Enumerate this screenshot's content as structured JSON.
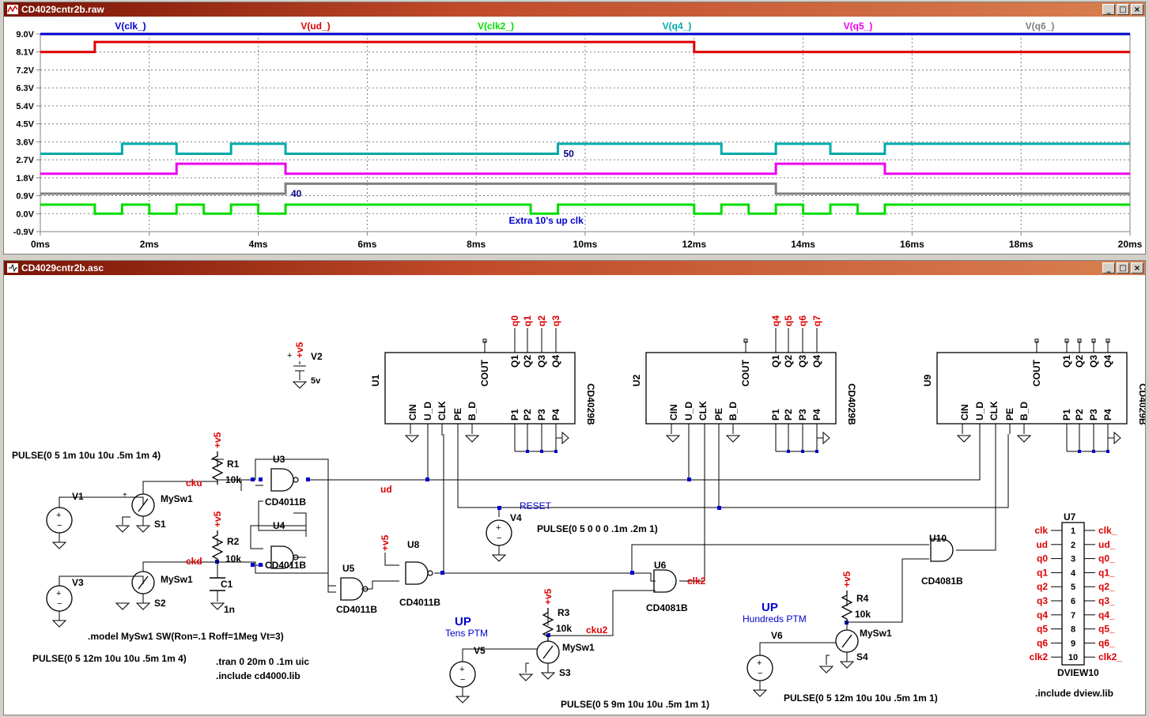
{
  "waveform_window": {
    "title": "CD4029cntr2b.raw",
    "buttons": [
      "_",
      "□",
      "×"
    ]
  },
  "schematic_window": {
    "title": "CD4029cntr2b.asc",
    "buttons": [
      "_",
      "□",
      "×"
    ]
  },
  "chart_data": {
    "type": "line",
    "x_unit": "ms",
    "xlim": [
      0,
      20
    ],
    "ylim": [
      -0.9,
      9.0
    ],
    "y_ticks": [
      "9.0V",
      "8.1V",
      "7.2V",
      "6.3V",
      "5.4V",
      "4.5V",
      "3.6V",
      "2.7V",
      "1.8V",
      "0.9V",
      "0.0V",
      "-0.9V"
    ],
    "x_ticks": [
      "0ms",
      "2ms",
      "4ms",
      "6ms",
      "8ms",
      "10ms",
      "12ms",
      "14ms",
      "16ms",
      "18ms",
      "20ms"
    ],
    "grid": true,
    "series": [
      {
        "name": "V(clk_)",
        "color": "#0000cc",
        "x": [
          0,
          20
        ],
        "y": [
          9.0,
          9.0
        ]
      },
      {
        "name": "V(ud_)",
        "color": "#dd0000",
        "x": [
          0,
          1,
          1,
          12,
          12,
          20
        ],
        "y": [
          8.1,
          8.1,
          8.6,
          8.6,
          8.1,
          8.1
        ]
      },
      {
        "name": "V(clk2_)",
        "color": "#00dd00",
        "x": [
          0,
          1,
          1,
          1.5,
          1.5,
          2,
          2,
          2.5,
          2.5,
          3,
          3,
          3.5,
          3.5,
          4,
          4,
          4.5,
          4.5,
          9,
          9,
          9.5,
          9.5,
          12,
          12,
          12.5,
          12.5,
          13,
          13,
          13.5,
          13.5,
          14,
          14,
          14.5,
          14.5,
          15,
          15,
          15.5,
          15.5,
          20
        ],
        "y": [
          0.45,
          0.45,
          0,
          0,
          0.45,
          0.45,
          0,
          0,
          0.45,
          0.45,
          0,
          0,
          0.45,
          0.45,
          0,
          0,
          0.45,
          0.45,
          0,
          0,
          0.45,
          0.45,
          0,
          0,
          0.45,
          0.45,
          0,
          0,
          0.45,
          0.45,
          0,
          0,
          0.45,
          0.45,
          0,
          0,
          0.45,
          0.45
        ]
      },
      {
        "name": "V(q4_)",
        "color": "#00aaaa",
        "x": [
          0,
          1.5,
          1.5,
          2.5,
          2.5,
          3.5,
          3.5,
          4.5,
          4.5,
          9.5,
          9.5,
          12.5,
          12.5,
          13.5,
          13.5,
          14.5,
          14.5,
          15.5,
          15.5,
          20
        ],
        "y": [
          3.0,
          3.0,
          3.5,
          3.5,
          3.0,
          3.0,
          3.5,
          3.5,
          3.0,
          3.0,
          3.5,
          3.5,
          3.0,
          3.0,
          3.5,
          3.5,
          3.0,
          3.0,
          3.5,
          3.5
        ]
      },
      {
        "name": "V(q5_)",
        "color": "#ee00ee",
        "x": [
          0,
          2.5,
          2.5,
          4.5,
          4.5,
          13.5,
          13.5,
          15.5,
          15.5,
          20
        ],
        "y": [
          2.0,
          2.0,
          2.5,
          2.5,
          2.0,
          2.0,
          2.5,
          2.5,
          2.0,
          2.0
        ]
      },
      {
        "name": "V(q6_)",
        "color": "#808080",
        "x": [
          0,
          4.5,
          4.5,
          13.5,
          13.5,
          20
        ],
        "y": [
          1.0,
          1.0,
          1.5,
          1.5,
          1.0,
          1.0
        ]
      }
    ],
    "annotations": [
      {
        "text": "50",
        "x": 9.6,
        "y": 2.85,
        "color": "#000080"
      },
      {
        "text": "40",
        "x": 4.6,
        "y": 0.85,
        "color": "#000080"
      },
      {
        "text": "Extra 10's up clk",
        "x": 8.6,
        "y": -0.5,
        "color": "#0000cc"
      }
    ]
  },
  "schematic": {
    "directives": {
      "pulse1": "PULSE(0 5 1m 10u 10u .5m 1m 4)",
      "pulse2": "PULSE(0 5 12m 10u 10u .5m 1m 4)",
      "pulse_reset": "PULSE(0 5 0 0 0 .1m .2m 1)",
      "pulse3": "PULSE(0 5 9m 10u 10u .5m 1m 1)",
      "pulse4": "PULSE(0 5 12m 10u 10u .5m 1m 1)",
      "model": ".model MySw1  SW(Ron=.1 Roff=1Meg Vt=3)",
      "tran": ".tran 0 20m 0 .1m uic",
      "include1": ".include cd4000.lib",
      "include2": ".include dview.lib"
    },
    "labels": {
      "up1": "UP",
      "tens": "Tens PTM",
      "up2": "UP",
      "hundreds": "Hundreds PTM",
      "reset": "RESET",
      "ud": "ud",
      "cku": "cku",
      "ckd": "ckd",
      "clk2": "clk2",
      "cku2": "cku2",
      "v2": "V2",
      "v2val": "5v",
      "plus": "+",
      "vplus": "+v5",
      "r1": "R1",
      "r2": "R2",
      "r3": "R3",
      "r4": "R4",
      "rval": "10k",
      "c1": "C1",
      "c1val": "1n",
      "v1": "V1",
      "v3": "V3",
      "v4": "V4",
      "v5": "V5",
      "v6": "V6",
      "s1": "S1",
      "s2": "S2",
      "s3": "S3",
      "s4": "S4",
      "sw": "MySw1",
      "u3": "U3",
      "u4": "U4",
      "u5": "U5",
      "u6": "U6",
      "u7": "U7",
      "u8": "U8",
      "u10": "U10",
      "nand": "CD4011B",
      "and": "CD4081B",
      "dview": "DVIEW10",
      "u1": "U1",
      "u2": "U2",
      "u9": "U9",
      "counter": "CD4029B",
      "pin_cin": "CIN",
      "pin_ud": "U_D",
      "pin_clk": "CLK",
      "pin_pe": "PE",
      "pin_bd": "B_D",
      "pin_p1": "P1",
      "pin_p2": "P2",
      "pin_p3": "P3",
      "pin_p4": "P4",
      "pin_cout": "COUT",
      "pin_q1": "Q1",
      "pin_q2": "Q2",
      "pin_q3": "Q3",
      "pin_q4": "Q4",
      "q0": "q0",
      "q1": "q1",
      "q2": "q2",
      "q3": "q3",
      "q4": "q4",
      "q5": "q5",
      "q6": "q6",
      "q7": "q7"
    },
    "dview_rows": [
      {
        "n": "1",
        "left": "clk",
        "right": "clk_"
      },
      {
        "n": "2",
        "left": "ud",
        "right": "ud_"
      },
      {
        "n": "3",
        "left": "q0",
        "right": "q0_"
      },
      {
        "n": "4",
        "left": "q1",
        "right": "q1_"
      },
      {
        "n": "5",
        "left": "q2",
        "right": "q2_"
      },
      {
        "n": "6",
        "left": "q3",
        "right": "q3_"
      },
      {
        "n": "7",
        "left": "q4",
        "right": "q4_"
      },
      {
        "n": "8",
        "left": "q5",
        "right": "q5_"
      },
      {
        "n": "9",
        "left": "q6",
        "right": "q6_"
      },
      {
        "n": "10",
        "left": "clk2",
        "right": "clk2_"
      }
    ]
  }
}
